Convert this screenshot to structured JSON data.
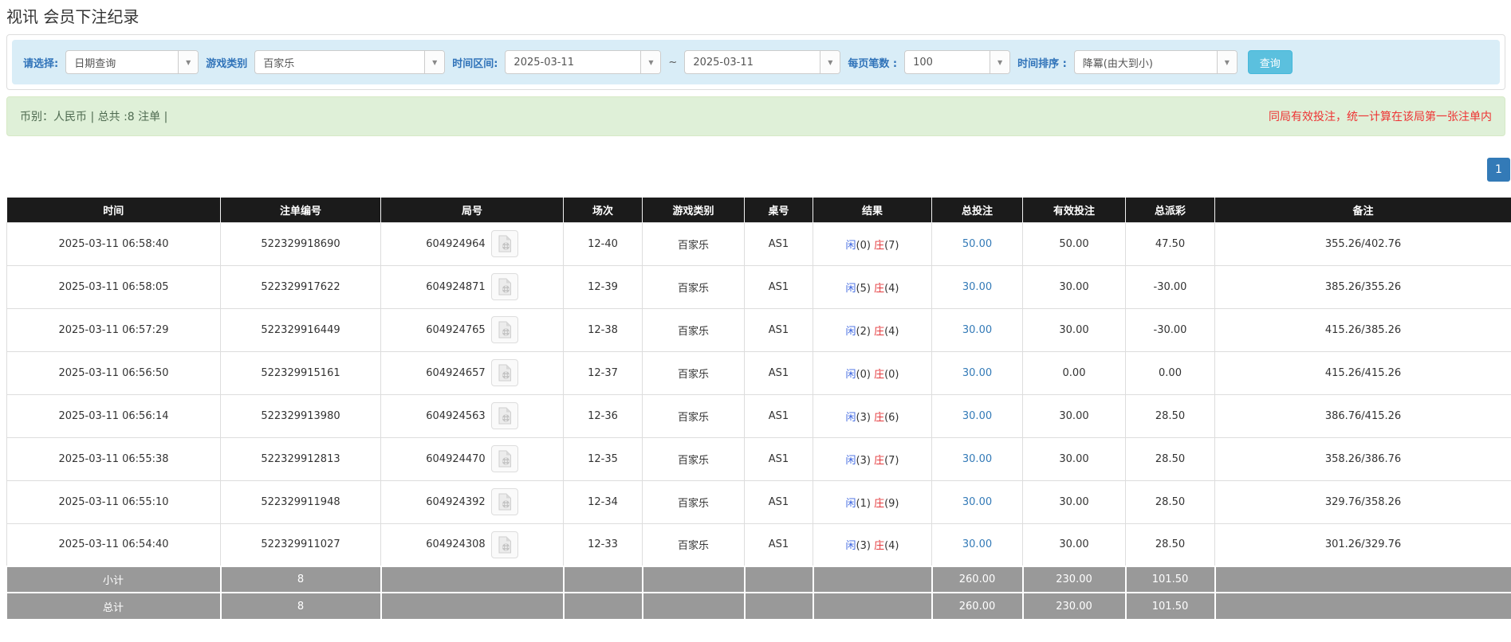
{
  "page": {
    "title": "视讯 会员下注纪录"
  },
  "icons": {
    "select_arrow": "▼"
  },
  "filters": {
    "select_label": "请选择:",
    "select_value": "日期查询",
    "game_label": "游戏类别",
    "game_value": "百家乐",
    "range_label": "时间区间:",
    "date_from": "2025-03-11",
    "tilde": "~",
    "date_to": "2025-03-11",
    "pagesize_label": "每页笔数 :",
    "pagesize_value": "100",
    "sort_label": "时间排序 :",
    "sort_value": "降冪(由大到小)",
    "search_button": "查询"
  },
  "summary": {
    "left": "币别：人民币 | 总共 :8 注单 |",
    "right": "同局有效投注，统一计算在该局第一张注单内"
  },
  "pagination": {
    "current": "1"
  },
  "table": {
    "headers": [
      "时间",
      "注单编号",
      "局号",
      "场次",
      "游戏类别",
      "桌号",
      "结果",
      "总投注",
      "有效投注",
      "总派彩",
      "备注"
    ],
    "rows": [
      {
        "time": "2025-03-11 06:58:40",
        "bet_id": "522329918690",
        "round_id": "604924964",
        "session": "12-40",
        "game": "百家乐",
        "table_no": "AS1",
        "player_label": "闲",
        "player_val": "(0)",
        "banker_label": "庄",
        "banker_val": "(7)",
        "total_bet": "50.00",
        "valid_bet": "50.00",
        "payout": "47.50",
        "remark": "355.26/402.76"
      },
      {
        "time": "2025-03-11 06:58:05",
        "bet_id": "522329917622",
        "round_id": "604924871",
        "session": "12-39",
        "game": "百家乐",
        "table_no": "AS1",
        "player_label": "闲",
        "player_val": "(5)",
        "banker_label": "庄",
        "banker_val": "(4)",
        "total_bet": "30.00",
        "valid_bet": "30.00",
        "payout": "-30.00",
        "remark": "385.26/355.26"
      },
      {
        "time": "2025-03-11 06:57:29",
        "bet_id": "522329916449",
        "round_id": "604924765",
        "session": "12-38",
        "game": "百家乐",
        "table_no": "AS1",
        "player_label": "闲",
        "player_val": "(2)",
        "banker_label": "庄",
        "banker_val": "(4)",
        "total_bet": "30.00",
        "valid_bet": "30.00",
        "payout": "-30.00",
        "remark": "415.26/385.26"
      },
      {
        "time": "2025-03-11 06:56:50",
        "bet_id": "522329915161",
        "round_id": "604924657",
        "session": "12-37",
        "game": "百家乐",
        "table_no": "AS1",
        "player_label": "闲",
        "player_val": "(0)",
        "banker_label": "庄",
        "banker_val": "(0)",
        "total_bet": "30.00",
        "valid_bet": "0.00",
        "payout": "0.00",
        "remark": "415.26/415.26"
      },
      {
        "time": "2025-03-11 06:56:14",
        "bet_id": "522329913980",
        "round_id": "604924563",
        "session": "12-36",
        "game": "百家乐",
        "table_no": "AS1",
        "player_label": "闲",
        "player_val": "(3)",
        "banker_label": "庄",
        "banker_val": "(6)",
        "total_bet": "30.00",
        "valid_bet": "30.00",
        "payout": "28.50",
        "remark": "386.76/415.26"
      },
      {
        "time": "2025-03-11 06:55:38",
        "bet_id": "522329912813",
        "round_id": "604924470",
        "session": "12-35",
        "game": "百家乐",
        "table_no": "AS1",
        "player_label": "闲",
        "player_val": "(3)",
        "banker_label": "庄",
        "banker_val": "(7)",
        "total_bet": "30.00",
        "valid_bet": "30.00",
        "payout": "28.50",
        "remark": "358.26/386.76"
      },
      {
        "time": "2025-03-11 06:55:10",
        "bet_id": "522329911948",
        "round_id": "604924392",
        "session": "12-34",
        "game": "百家乐",
        "table_no": "AS1",
        "player_label": "闲",
        "player_val": "(1)",
        "banker_label": "庄",
        "banker_val": "(9)",
        "total_bet": "30.00",
        "valid_bet": "30.00",
        "payout": "28.50",
        "remark": "329.76/358.26"
      },
      {
        "time": "2025-03-11 06:54:40",
        "bet_id": "522329911027",
        "round_id": "604924308",
        "session": "12-33",
        "game": "百家乐",
        "table_no": "AS1",
        "player_label": "闲",
        "player_val": "(3)",
        "banker_label": "庄",
        "banker_val": "(4)",
        "total_bet": "30.00",
        "valid_bet": "30.00",
        "payout": "28.50",
        "remark": "301.26/329.76"
      }
    ],
    "subtotal": {
      "label": "小计",
      "count": "8",
      "total_bet": "260.00",
      "valid_bet": "230.00",
      "payout": "101.50"
    },
    "total": {
      "label": "总计",
      "count": "8",
      "total_bet": "260.00",
      "valid_bet": "230.00",
      "payout": "101.50"
    }
  },
  "colors": {
    "accent_blue": "#337ab7",
    "search_button_blue": "#5bc0de",
    "filter_bar_bg": "#d9edf7",
    "filter_label_blue": "#3073b9",
    "summary_bg": "#dff0d8",
    "notice_red": "#ee3333",
    "header_bg": "#1b1b1b",
    "totals_gray": "#999999",
    "player_blue": "#4169e1",
    "banker_red": "#e4393c",
    "negative_red": "#ff2222"
  }
}
